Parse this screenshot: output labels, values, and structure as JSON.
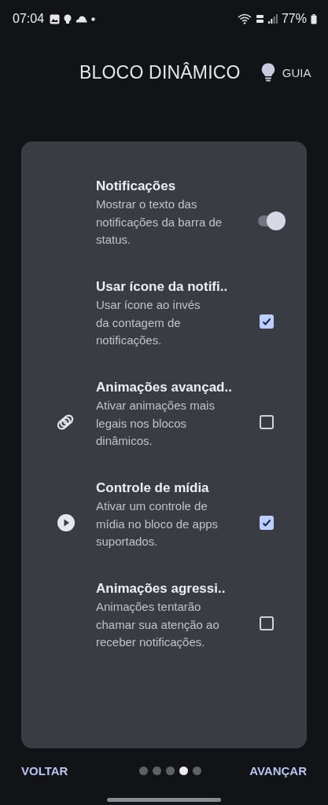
{
  "status_bar": {
    "time": "07:04",
    "battery": "77%"
  },
  "header": {
    "title": "BLOCO DINÂMICO",
    "guide": "GUIA"
  },
  "settings": [
    {
      "kind": "switch",
      "title": "Notificações",
      "description": "Mostrar o texto das\nnotificações da barra de\nstatus.",
      "on": true
    },
    {
      "kind": "checkbox",
      "title": "Usar ícone da notifi..",
      "description": "Usar ícone ao invés\nda contagem de\nnotificações.",
      "checked": true
    },
    {
      "kind": "checkbox",
      "title": "Animações avançad..",
      "description": "Ativar animações mais\nlegais nos blocos\ndinâmicos.",
      "checked": false
    },
    {
      "kind": "checkbox",
      "title": "Controle de mídia",
      "description": "Ativar um controle de\nmídia no bloco de apps\nsuportados.",
      "checked": true
    },
    {
      "kind": "checkbox",
      "title": "Animações agressi..",
      "description": "Animações tentarão\nchamar sua atenção ao\nreceber notificações.",
      "checked": false
    }
  ],
  "footer": {
    "back": "VOLTAR",
    "next": "AVANÇAR",
    "pages": [
      {
        "selected": false
      },
      {
        "selected": false
      },
      {
        "selected": false
      },
      {
        "selected": true
      },
      {
        "selected": false
      }
    ]
  }
}
